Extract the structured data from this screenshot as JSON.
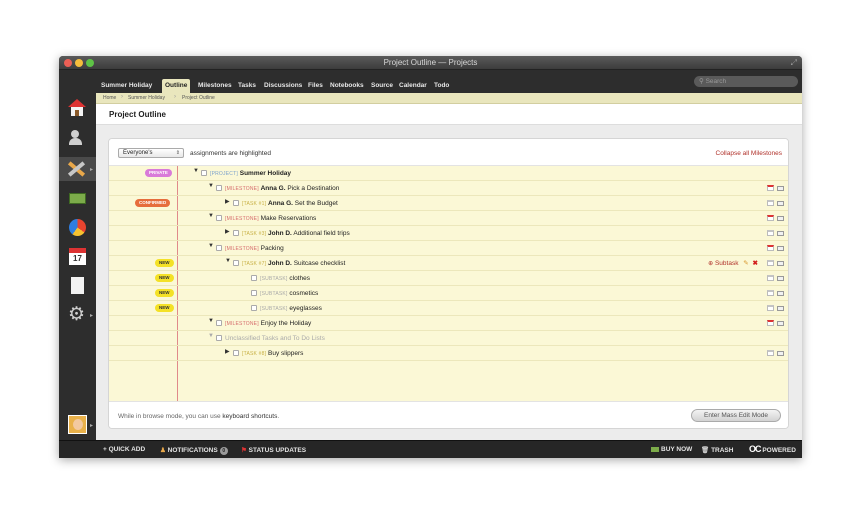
{
  "window": {
    "title": "Project Outline — Projects"
  },
  "nav": {
    "project_name": "Summer Holiday",
    "tabs": [
      "Outline",
      "Milestones",
      "Tasks",
      "Discussions",
      "Files",
      "Notebooks",
      "Source",
      "Calendar",
      "Todo"
    ],
    "active_tab": "Outline",
    "search_placeholder": "Search"
  },
  "breadcrumb": [
    "Home",
    "Summer Holiday",
    "Project Outline"
  ],
  "page": {
    "title": "Project Outline"
  },
  "filter": {
    "selected": "Everyone's",
    "text": "assignments are highlighted",
    "collapse_label": "Collapse all Milestones"
  },
  "outline": {
    "rows": [
      {
        "badge": "PRIVATE",
        "tag": "[PROJECT]",
        "person": "",
        "text": "Summer Holiday"
      },
      {
        "badge": "",
        "tag": "[MILESTONE]",
        "person": "Anna G.",
        "text": "Pick a Destination"
      },
      {
        "badge": "CONFIRMED",
        "tag": "[TASK #1]",
        "person": "Anna G.",
        "text": "Set the Budget"
      },
      {
        "badge": "",
        "tag": "[MILESTONE]",
        "person": "",
        "text": "Make Reservations"
      },
      {
        "badge": "",
        "tag": "[TASK #3]",
        "person": "John D.",
        "text": "Additional field trips"
      },
      {
        "badge": "",
        "tag": "[MILESTONE]",
        "person": "",
        "text": "Packing"
      },
      {
        "badge": "NEW",
        "tag": "[TASK #7]",
        "person": "John D.",
        "text": "Suitcase checklist"
      },
      {
        "badge": "NEW",
        "tag": "[SUBTASK]",
        "person": "",
        "text": "clothes"
      },
      {
        "badge": "NEW",
        "tag": "[SUBTASK]",
        "person": "",
        "text": "cosmetics"
      },
      {
        "badge": "NEW",
        "tag": "[SUBTASK]",
        "person": "",
        "text": "eyeglasses"
      },
      {
        "badge": "",
        "tag": "[MILESTONE]",
        "person": "",
        "text": "Enjoy the Holiday"
      },
      {
        "badge": "",
        "tag": "",
        "person": "",
        "text": "Unclassified Tasks and To Do Lists"
      },
      {
        "badge": "",
        "tag": "[TASK #8]",
        "person": "",
        "text": "Buy slippers"
      }
    ],
    "subtask_label": "Subtask"
  },
  "footer": {
    "text_prefix": "While in browse mode, you can use",
    "shortcuts_link": "keyboard shortcuts",
    "text_suffix": ".",
    "mass_edit_label": "Enter Mass Edit Mode"
  },
  "bottombar": {
    "quick_add": "QUICK ADD",
    "notifications": "NOTIFICATIONS",
    "notifications_count": "0",
    "status_updates": "STATUS UPDATES",
    "buy_now": "BUY NOW",
    "trash": "TRASH",
    "powered": "POWERED"
  },
  "sidebar": {
    "calendar_day": "17"
  },
  "colors": {
    "accent": "#e9e6bd",
    "outline_bg": "#fbf8d6",
    "link_red": "#b0312a"
  }
}
